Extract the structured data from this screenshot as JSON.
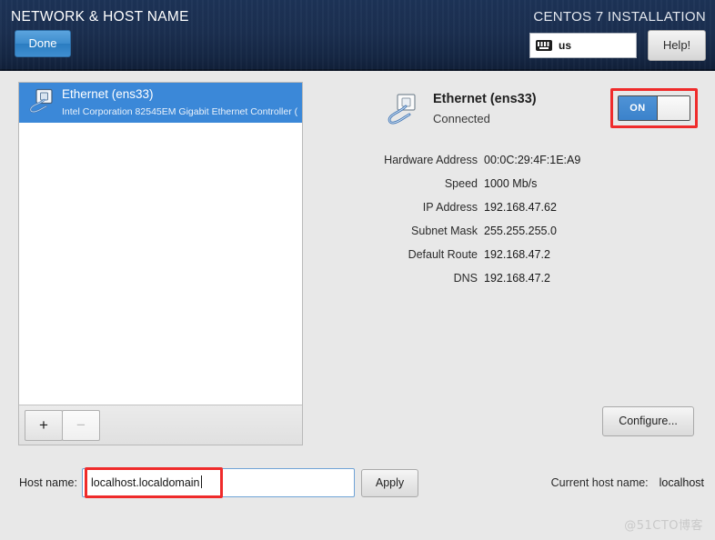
{
  "header": {
    "title": "NETWORK & HOST NAME",
    "product_title": "CENTOS 7 INSTALLATION",
    "done_label": "Done",
    "help_label": "Help!",
    "keyboard_layout": "us",
    "keyboard_icon": "keyboard-icon"
  },
  "device_list": {
    "items": [
      {
        "icon": "wired-network-icon",
        "name": "Ethernet (ens33)",
        "description": "Intel Corporation 82545EM Gigabit Ethernet Controller (",
        "selected": true
      }
    ],
    "add_label": "+",
    "remove_label": "−"
  },
  "details": {
    "icon": "wired-network-icon",
    "device_title": "Ethernet (ens33)",
    "connection_status": "Connected",
    "toggle": {
      "state_label": "ON",
      "on": true,
      "highlight_color": "#ef2b2b"
    },
    "rows": [
      {
        "label": "Hardware Address",
        "value": "00:0C:29:4F:1E:A9"
      },
      {
        "label": "Speed",
        "value": "1000 Mb/s"
      },
      {
        "label": "IP Address",
        "value": "192.168.47.62"
      },
      {
        "label": "Subnet Mask",
        "value": "255.255.255.0"
      },
      {
        "label": "Default Route",
        "value": "192.168.47.2"
      },
      {
        "label": "DNS",
        "value": "192.168.47.2"
      }
    ],
    "configure_label": "Configure..."
  },
  "bottom": {
    "hostname_label": "Host name:",
    "hostname_value": "localhost.localdomain",
    "apply_label": "Apply",
    "current_host_label": "Current host name:",
    "current_host_value": "localhost"
  },
  "watermark": "@51CTO博客",
  "colors": {
    "header_bg": "#1b2f50",
    "accent_blue": "#3b88d8",
    "selection_blue": "#3b88d8",
    "annotation_red": "#ef2b2b",
    "page_bg": "#e8e8e8"
  }
}
